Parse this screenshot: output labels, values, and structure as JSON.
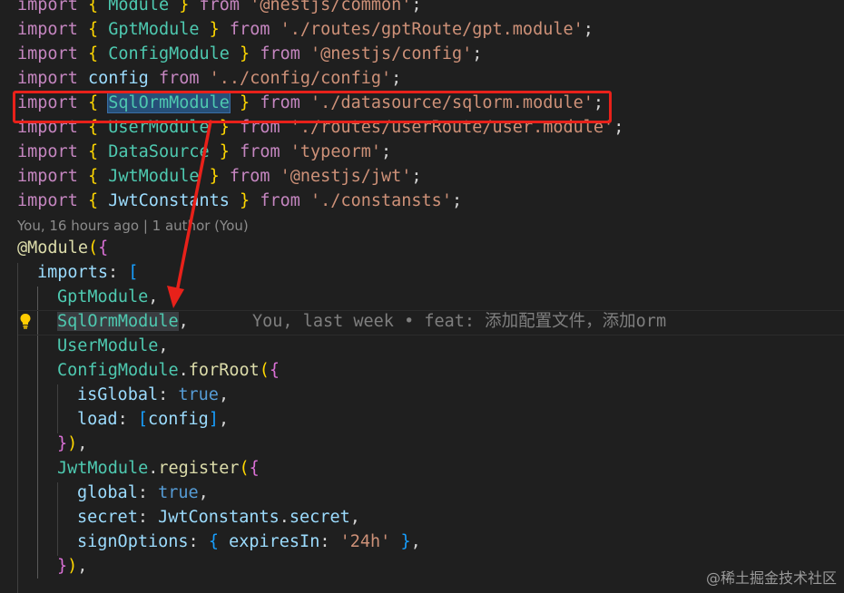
{
  "imports": [
    {
      "name": "Module",
      "from": "'@nestjs/common'"
    },
    {
      "name": "GptModule",
      "from": "'./routes/gptRoute/gpt.module'"
    },
    {
      "name": "ConfigModule",
      "from": "'@nestjs/config'"
    },
    {
      "name": "config",
      "from": "'../config/config'"
    },
    {
      "name": "SqlOrmModule",
      "from": "'./datasource/sqlorm.module'"
    },
    {
      "name": "UserModule",
      "from": "'./routes/userRoute/user.module'"
    },
    {
      "name": "DataSource",
      "from": "'typeorm'"
    },
    {
      "name": "JwtModule",
      "from": "'@nestjs/jwt'"
    },
    {
      "name": "JwtConstants",
      "from": "'./constansts'"
    }
  ],
  "codelens": "You, 16 hours ago | 1 author (You)",
  "decorator": "@Module",
  "imports_key": "imports",
  "modules": {
    "gpt": "GptModule",
    "sqlorm": "SqlOrmModule",
    "user": "UserModule",
    "config": "ConfigModule",
    "jwt": "JwtModule"
  },
  "inline_blame": "You, last week • feat: 添加配置文件，添加orm",
  "config_call": {
    "method": "forRoot",
    "isGlobal_key": "isGlobal",
    "isGlobal_val": "true",
    "load_key": "load",
    "load_val": "config"
  },
  "jwt_call": {
    "method": "register",
    "global_key": "global",
    "global_val": "true",
    "secret_key": "secret",
    "secret_obj": "JwtConstants",
    "secret_prop": "secret",
    "signOptions_key": "signOptions",
    "expiresIn_key": "expiresIn",
    "expiresIn_val": "'24h'"
  },
  "keywords": {
    "import": "import",
    "from": "from"
  },
  "watermark": "@稀土掘金技术社区",
  "colors": {
    "background": "#1f1f1f",
    "highlight_box": "#e8211a",
    "arrow": "#e8211a"
  }
}
